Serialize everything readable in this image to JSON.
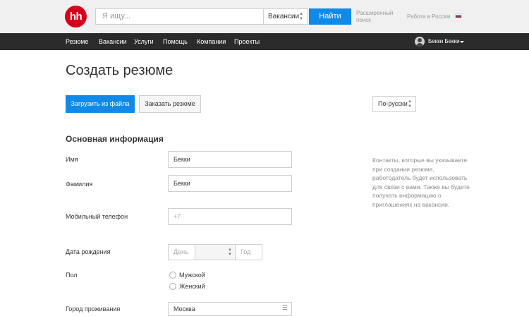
{
  "header": {
    "logo_text": "hh",
    "search_placeholder": "Я ищу...",
    "search_category": "Вакансии",
    "find_label": "Найти",
    "advanced_search": "Расширенный поиск",
    "work_in_russia": "Работа в России",
    "brand_color": "#d6001c",
    "accent_color": "#0f8ae8"
  },
  "nav": {
    "items": [
      {
        "label": "Резюме"
      },
      {
        "label": "Вакансии"
      },
      {
        "label": "Услуги"
      },
      {
        "label": "Помощь"
      },
      {
        "label": "Компании"
      },
      {
        "label": "Проекты"
      }
    ],
    "user_name": "Бекки Бекки"
  },
  "page": {
    "title": "Создать резюме",
    "upload_button": "Загрузить из файла",
    "order_button": "Заказать резюме",
    "language_select": "По-русски",
    "section_title": "Основная информация",
    "hint": "Контакты, которые вы указываете при создании резюме, работодатель будет использовать для связи с вами. Также вы будете получать информацию о приглашениях на вакансии."
  },
  "form": {
    "first_name": {
      "label": "Имя",
      "value": "Бекки"
    },
    "last_name": {
      "label": "Фамилия",
      "value": "Бекки"
    },
    "phone": {
      "label": "Мобильный телефон",
      "placeholder": "+7"
    },
    "birth_date": {
      "label": "Дата рождения",
      "day_placeholder": "День",
      "year_placeholder": "Год"
    },
    "gender": {
      "label": "Пол",
      "options": [
        "Мужской",
        "Женский"
      ]
    },
    "city": {
      "label": "Город проживания",
      "value": "Москва"
    }
  }
}
